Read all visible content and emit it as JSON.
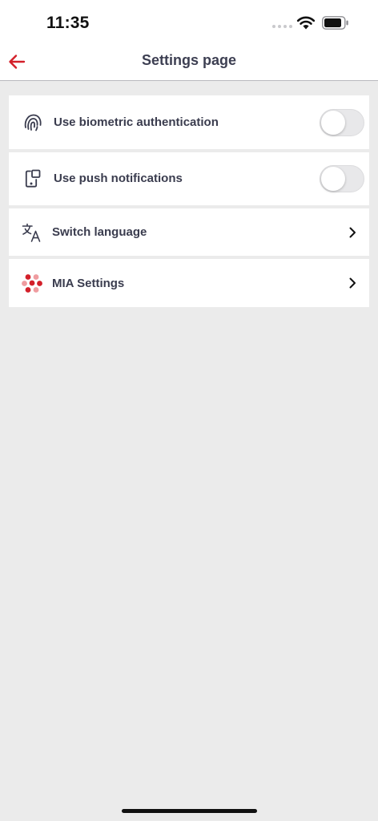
{
  "status_bar": {
    "time": "11:35"
  },
  "header": {
    "title": "Settings page",
    "back_icon": "arrow-left-icon",
    "accent_color": "#d3202a"
  },
  "settings": {
    "items": [
      {
        "label": "Use biometric authentication",
        "icon": "fingerprint-icon",
        "control": "toggle",
        "enabled": false
      },
      {
        "label": "Use push notifications",
        "icon": "phone-notification-icon",
        "control": "toggle",
        "enabled": false
      },
      {
        "label": "Switch language",
        "icon": "translate-icon",
        "control": "chevron"
      },
      {
        "label": "MIA Settings",
        "icon": "mia-logo-icon",
        "control": "chevron"
      }
    ]
  }
}
